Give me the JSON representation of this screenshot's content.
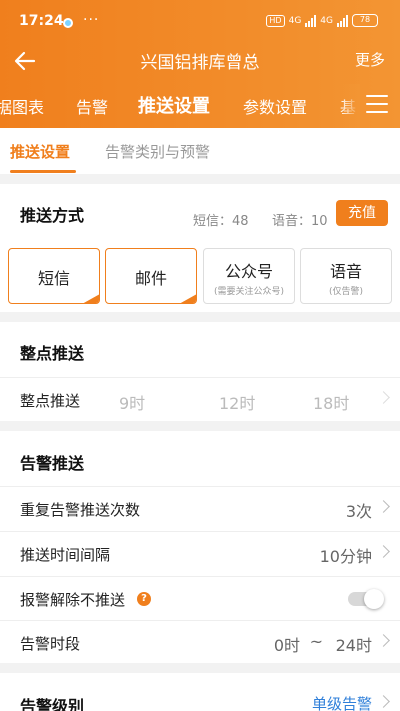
{
  "status_bar": {
    "time": "17:24",
    "net_badge": "HD",
    "net1": "4G",
    "net2": "4G",
    "battery": "78"
  },
  "header": {
    "title": "兴国铝排库曾总",
    "more_label": "更多"
  },
  "tabs": [
    {
      "label": "据图表"
    },
    {
      "label": "告警"
    },
    {
      "label": "推送设置"
    },
    {
      "label": "参数设置"
    },
    {
      "label": "基"
    }
  ],
  "subtabs": [
    {
      "label": "推送设置"
    },
    {
      "label": "告警类别与预警"
    }
  ],
  "push_method": {
    "title": "推送方式",
    "sms_count": "短信：48",
    "voice_count": "语音：10",
    "recharge_label": "充值",
    "methods": [
      {
        "label": "短信",
        "sub": ""
      },
      {
        "label": "邮件",
        "sub": ""
      },
      {
        "label": "公众号",
        "sub": "(需要关注公众号)"
      },
      {
        "label": "语音",
        "sub": "(仅告警)"
      }
    ]
  },
  "hourly": {
    "title": "整点推送",
    "row_label": "整点推送",
    "hours": [
      "9时",
      "12时",
      "18时"
    ]
  },
  "alarm_push": {
    "title": "告警推送",
    "repeat_label": "重复告警推送次数",
    "repeat_value": "3次",
    "interval_label": "推送时间间隔",
    "interval_value": "10分钟",
    "no_push_label": "报警解除不推送",
    "no_push_help": "?",
    "period_label": "告警时段",
    "period_start": "0时",
    "period_sep": "~",
    "period_end": "24时"
  },
  "alarm_level": {
    "title": "告警级别",
    "value": "单级告警"
  },
  "colors": {
    "accent": "#f07f1d",
    "background": "#f2f2f2"
  }
}
